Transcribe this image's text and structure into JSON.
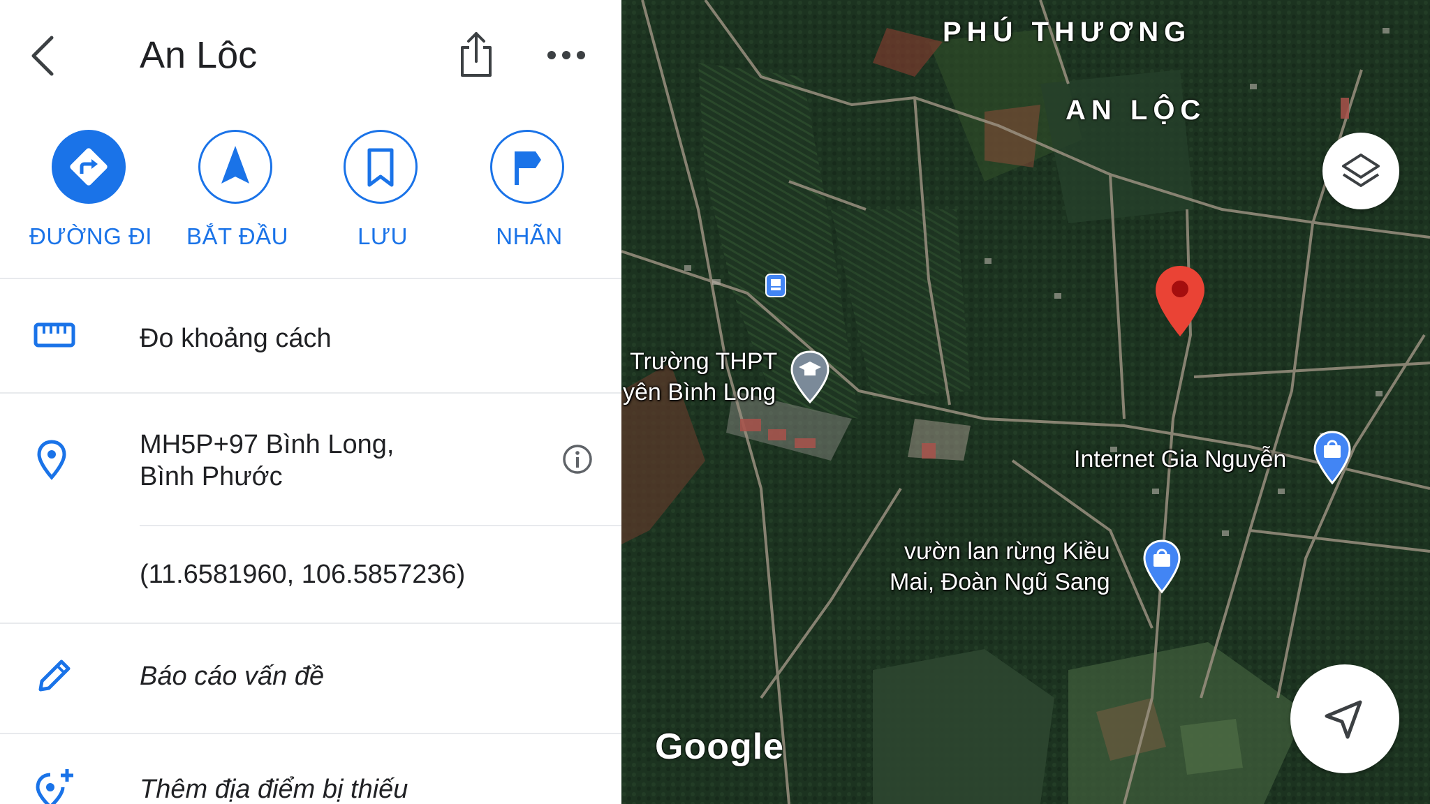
{
  "header": {
    "title": "An Lôc"
  },
  "actions": [
    {
      "label": "ĐƯỜNG ĐI",
      "icon": "directions-icon"
    },
    {
      "label": "BẮT ĐẦU",
      "icon": "navigation-arrow-icon"
    },
    {
      "label": "LƯU",
      "icon": "bookmark-icon"
    },
    {
      "label": "NHÃN",
      "icon": "flag-icon"
    }
  ],
  "rows": {
    "measure": "Đo khoảng cách",
    "address_line1": "MH5P+97 Bình Long,",
    "address_line2": "Bình Phước",
    "coordinates": "(11.6581960, 106.5857236)",
    "report": "Báo cáo vấn đề",
    "add_place": "Thêm địa điểm bị thiếu"
  },
  "map": {
    "area_labels": {
      "phu_thuong": "PHÚ THƯƠNG",
      "an_loc": "AN LỘC"
    },
    "pois": {
      "school_line1": "Trường THPT",
      "school_line2": "yên Bình Long",
      "internet": "Internet Gia Nguyễn",
      "garden_line1": "vườn lan rừng Kiều",
      "garden_line2": "Mai, Đoàn Ngũ Sang"
    },
    "logo": "Google"
  },
  "colors": {
    "accent": "#1a73e8",
    "pin": "#ea4335",
    "divider": "#e8eaed"
  }
}
